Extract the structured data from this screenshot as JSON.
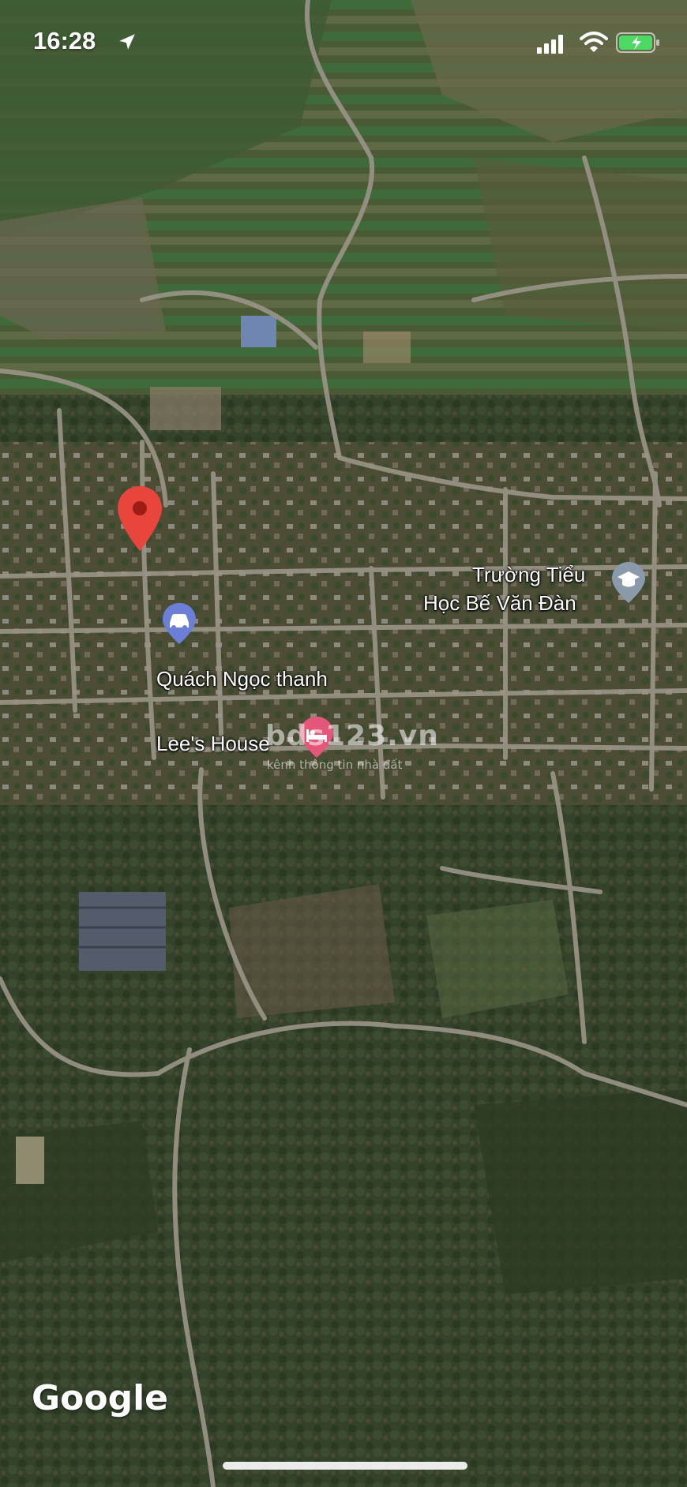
{
  "status_bar": {
    "time": "16:28",
    "icons": [
      "location-arrow-icon",
      "cellular-signal-icon",
      "wifi-icon",
      "battery-charging-icon"
    ]
  },
  "map": {
    "type": "satellite",
    "dropped_pin_color": "#e8453c",
    "pois": [
      {
        "name": "Trường Tiểu\nHọc Bế Văn Đàn",
        "line1": "Trường Tiểu",
        "line2": "Học Bế Văn Đàn",
        "icon": "graduation-cap-icon"
      },
      {
        "name": "Quách Ngọc thanh",
        "icon": "car-service-icon"
      },
      {
        "name": "Lee's House",
        "icon": "hotel-bed-icon"
      }
    ],
    "watermark": {
      "brand": "bds123.vn",
      "tagline": "kênh thông tin nhà đất"
    },
    "attribution": "Google"
  }
}
